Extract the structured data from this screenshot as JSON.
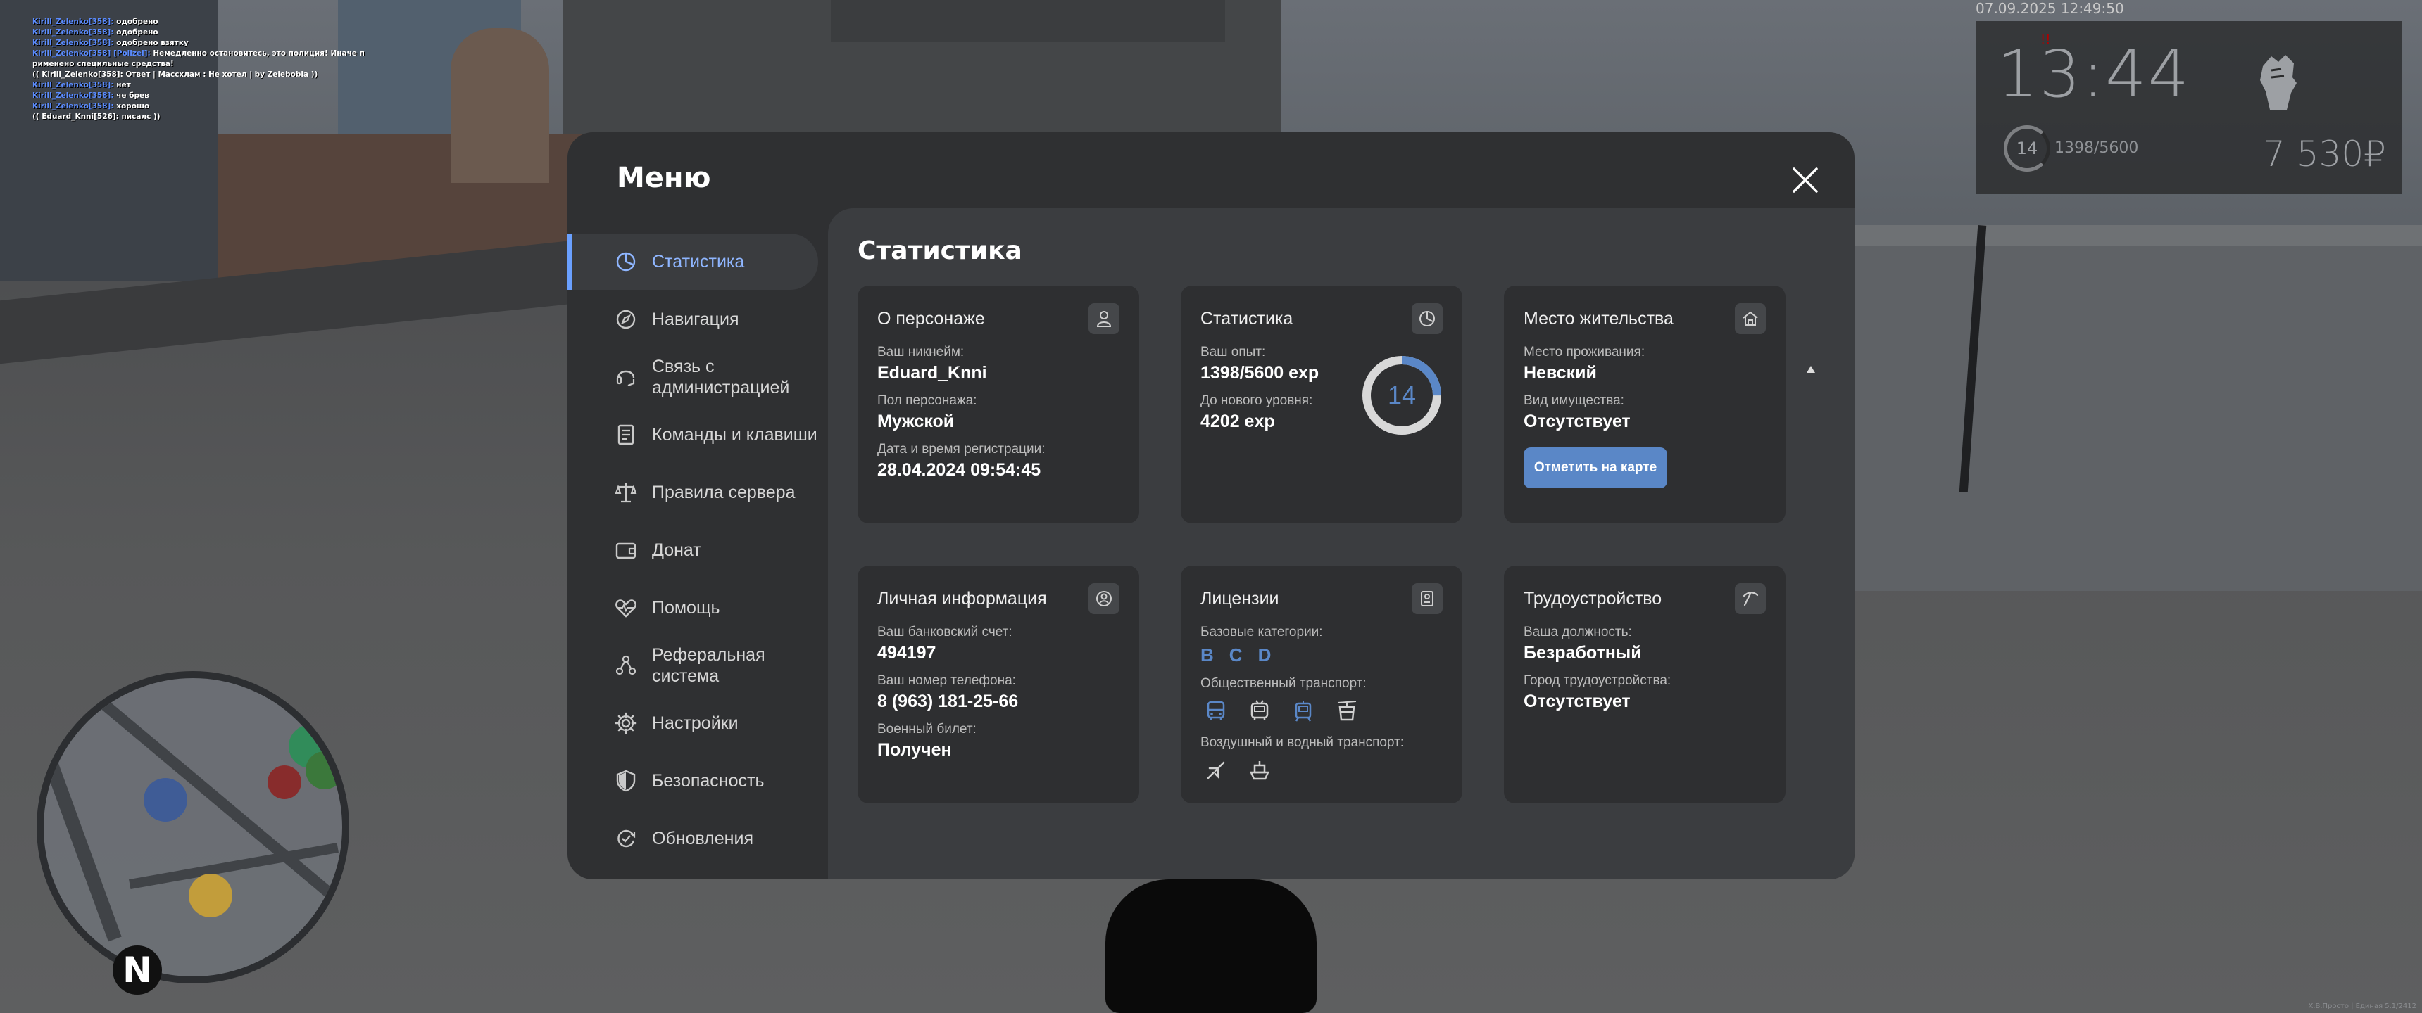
{
  "chat": [
    {
      "name": "Kirill_Zelenko[358]:",
      "text": "одобрено"
    },
    {
      "name": "Kirill_Zelenko[358]:",
      "text": "одобрено"
    },
    {
      "name": "Kirill_Zelenko[358]:",
      "text": "одобрено взятку"
    },
    {
      "name": "Kirill_Zelenko[358] [Polizei]:",
      "text": "Немедленно остановитесь, это полиция! Иначе п"
    },
    {
      "name": "",
      "text": "рименено специльные средства!"
    },
    {
      "name": "",
      "text": "(( Kirill_Zelenko[358]: Ответ | Массхлам : Не хотел | by Zelebobia ))"
    },
    {
      "name": "Kirill_Zelenko[358]:",
      "text": "нет"
    },
    {
      "name": "Kirill_Zelenko[358]:",
      "text": "че брев"
    },
    {
      "name": "Kirill_Zelenko[358]:",
      "text": "хорошо"
    },
    {
      "name": "",
      "text": "(( Eduard_Knni[526]: писалс ))"
    }
  ],
  "hud": {
    "datetime": "07.09.2025 12:49:50",
    "wanted": "!!",
    "time": "13:44",
    "level": "14",
    "exp": "1398/5600",
    "money": "7 530₽"
  },
  "map": {
    "north": "N"
  },
  "build": "Х.В.Просто | Единая 5.1/2412",
  "menu": {
    "title": "Меню",
    "close_icon": "close-icon",
    "nav": [
      {
        "label": "Статистика",
        "icon": "pie-chart-icon",
        "active": true
      },
      {
        "label": "Навигация",
        "icon": "compass-icon",
        "active": false
      },
      {
        "label": "Связь с администрацией",
        "icon": "headset-icon",
        "active": false
      },
      {
        "label": "Команды и клавиши",
        "icon": "document-icon",
        "active": false
      },
      {
        "label": "Правила сервера",
        "icon": "scales-icon",
        "active": false
      },
      {
        "label": "Донат",
        "icon": "wallet-icon",
        "active": false
      },
      {
        "label": "Помощь",
        "icon": "heart-pulse-icon",
        "active": false
      },
      {
        "label": "Реферальная система",
        "icon": "network-icon",
        "active": false
      },
      {
        "label": "Настройки",
        "icon": "gear-icon",
        "active": false
      },
      {
        "label": "Безопасность",
        "icon": "shield-icon",
        "active": false
      },
      {
        "label": "Обновления",
        "icon": "refresh-check-icon",
        "active": false
      }
    ]
  },
  "stats": {
    "title": "Статистика",
    "character": {
      "title": "О персонаже",
      "icon": "user-icon",
      "nickname_label": "Ваш никнейм:",
      "nickname": "Eduard_Knni",
      "gender_label": "Пол персонажа:",
      "gender": "Мужской",
      "reg_label": "Дата и время регистрации:",
      "reg": "28.04.2024 09:54:45"
    },
    "progress": {
      "title": "Статистика",
      "icon": "pie-chart-icon",
      "exp_label": "Ваш опыт:",
      "exp": "1398/5600 exp",
      "next_label": "До нового уровня:",
      "next": "4202 exp",
      "level": "14",
      "fraction": 0.25,
      "ring_color": "#5a87c7"
    },
    "residence": {
      "title": "Место жительства",
      "icon": "house-icon",
      "place_label": "Место проживания:",
      "place": "Невский",
      "property_label": "Вид имущества:",
      "property": "Отсутствует",
      "button": "Отметить на карте"
    },
    "personal": {
      "title": "Личная информация",
      "icon": "user-circle-icon",
      "bank_label": "Ваш банковский счет:",
      "bank": "494197",
      "phone_label": "Ваш номер телефона:",
      "phone": "8 (963) 181-25-66",
      "military_label": "Военный билет:",
      "military": "Получен"
    },
    "licenses": {
      "title": "Лицензии",
      "icon": "id-card-icon",
      "base_label": "Базовые категории:",
      "base": [
        "B",
        "C",
        "D"
      ],
      "public_label": "Общественный транспорт:",
      "public_icons": [
        "bus-icon",
        "trolleybus-icon",
        "tram-icon",
        "cable-car-icon"
      ],
      "air_label": "Воздушный и водный транспорт:",
      "air_icons": [
        "plane-icon",
        "boat-icon"
      ]
    },
    "job": {
      "title": "Трудоустройство",
      "icon": "pickaxe-icon",
      "position_label": "Ваша должность:",
      "position": "Безработный",
      "city_label": "Город трудоустройства:",
      "city": "Отсутствует"
    }
  }
}
